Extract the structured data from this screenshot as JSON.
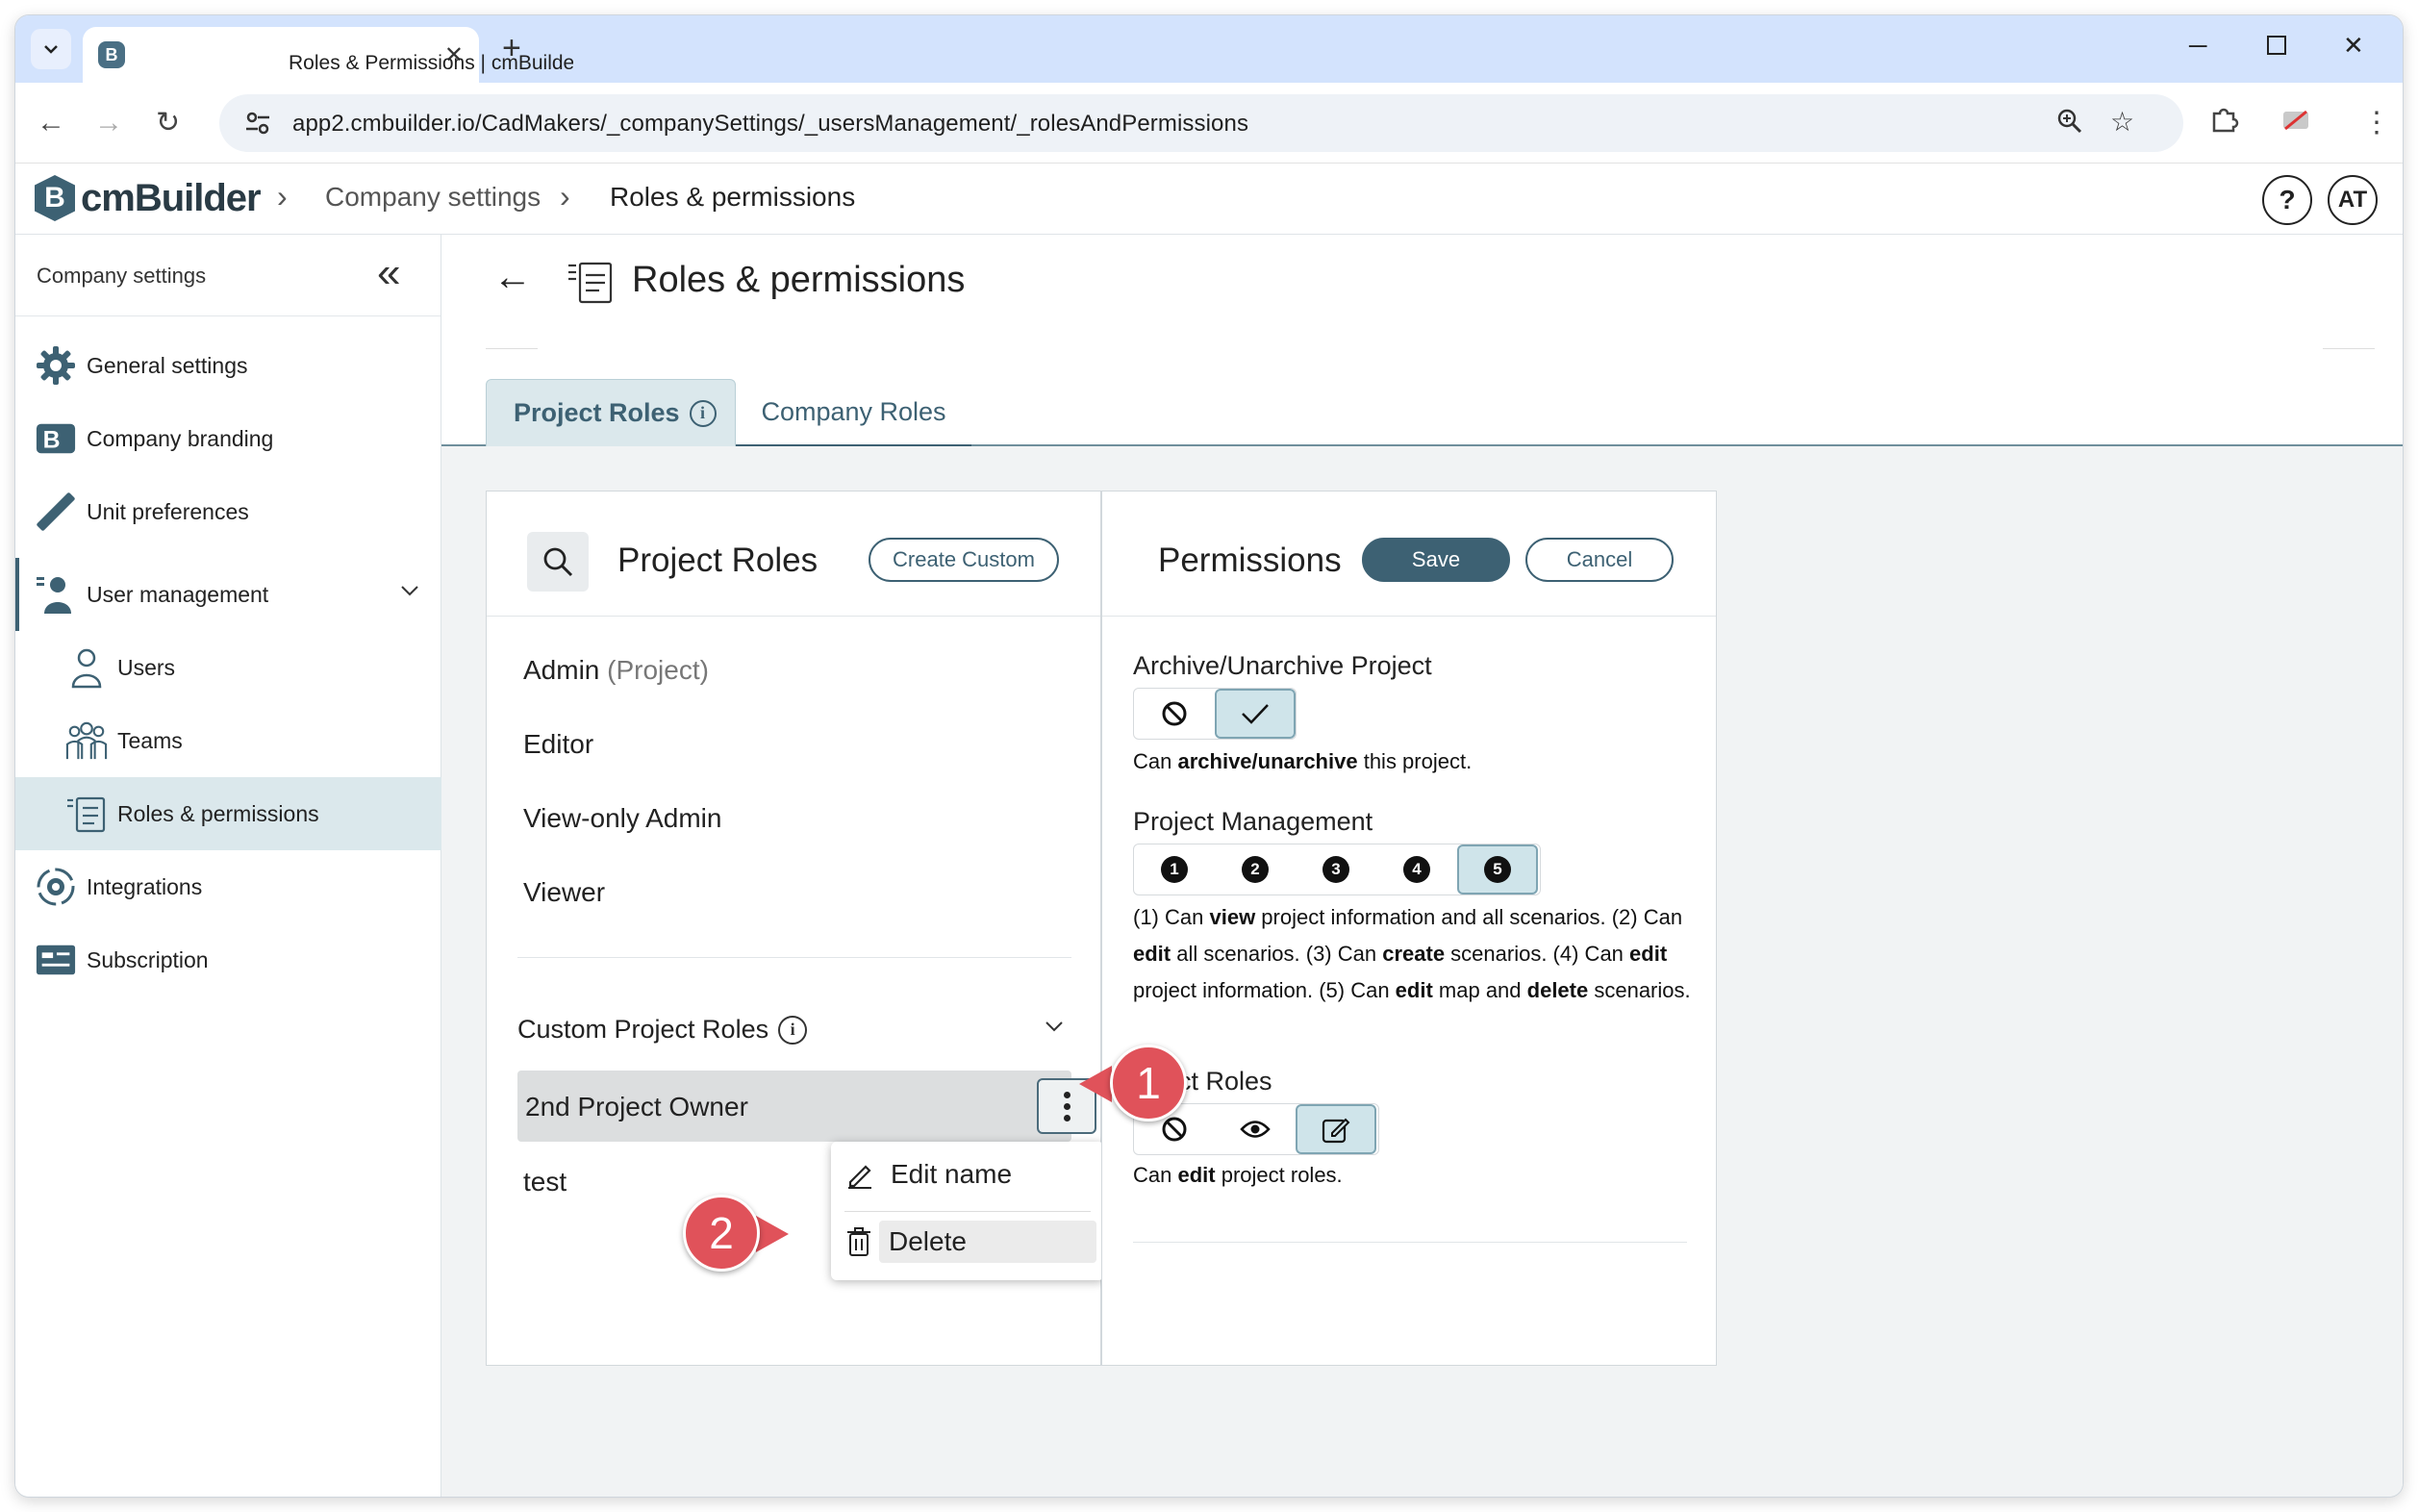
{
  "browser": {
    "tab_title": "Roles & Permissions | cmBuilder",
    "favicon_letter": "B",
    "url": "app2.cmbuilder.io/CadMakers/_companySettings/_usersManagement/_rolesAndPermissions"
  },
  "app": {
    "logo_letter": "B",
    "logo_text": "cmBuilder",
    "breadcrumb": [
      "Company settings",
      "Roles & permissions"
    ],
    "help_label": "?",
    "avatar_initials": "AT"
  },
  "sidebar": {
    "header": "Company settings",
    "items": [
      {
        "label": "General settings",
        "icon": "gear-icon"
      },
      {
        "label": "Company branding",
        "icon": "branding-icon"
      },
      {
        "label": "Unit preferences",
        "icon": "ruler-icon"
      },
      {
        "label": "User management",
        "icon": "user-management-icon",
        "expanded": true
      },
      {
        "label": "Users",
        "icon": "user-icon"
      },
      {
        "label": "Teams",
        "icon": "teams-icon"
      },
      {
        "label": "Roles & permissions",
        "icon": "roles-icon",
        "active": true
      },
      {
        "label": "Integrations",
        "icon": "integrations-icon"
      },
      {
        "label": "Subscription",
        "icon": "card-icon"
      }
    ]
  },
  "page": {
    "title": "Roles & permissions",
    "tabs": [
      {
        "label": "Project Roles",
        "active": true
      },
      {
        "label": "Company Roles",
        "active": false
      }
    ]
  },
  "roles_panel": {
    "title": "Project Roles",
    "create_button": "Create Custom",
    "roles": [
      {
        "name": "Admin",
        "suffix": "(Project)"
      },
      {
        "name": "Editor",
        "suffix": ""
      },
      {
        "name": "View-only Admin",
        "suffix": ""
      },
      {
        "name": "Viewer",
        "suffix": ""
      }
    ],
    "custom_section_title": "Custom Project Roles",
    "custom_roles": [
      "2nd Project Owner",
      "test"
    ],
    "context_menu": {
      "edit": "Edit name",
      "delete": "Delete"
    }
  },
  "permissions_panel": {
    "title": "Permissions",
    "save": "Save",
    "cancel": "Cancel",
    "groups": [
      {
        "heading": "Archive/Unarchive Project",
        "selected": "allow",
        "desc_parts": [
          "Can ",
          "archive/unarchive",
          " this project."
        ]
      },
      {
        "heading": "Project Management",
        "levels": [
          "1",
          "2",
          "3",
          "4",
          "5"
        ],
        "selected_level": "5",
        "desc_parts": [
          "(1) Can ",
          "view",
          " project information and all scenarios. (2) Can ",
          "edit",
          " all scenarios. (3) Can ",
          "create",
          " scenarios. (4) Can ",
          "edit",
          " project information. (5) Can ",
          "edit",
          " map and ",
          "delete",
          " scenarios."
        ]
      },
      {
        "heading": "ject Roles",
        "selected": "edit",
        "desc_parts": [
          "Can ",
          "edit",
          " project roles."
        ]
      }
    ]
  },
  "callouts": [
    "1",
    "2"
  ],
  "colors": {
    "accent": "#3d6173",
    "selected_bg": "#cfe4ea",
    "callout": "#e0525a",
    "browser_tabstrip": "#d3e3fd"
  }
}
